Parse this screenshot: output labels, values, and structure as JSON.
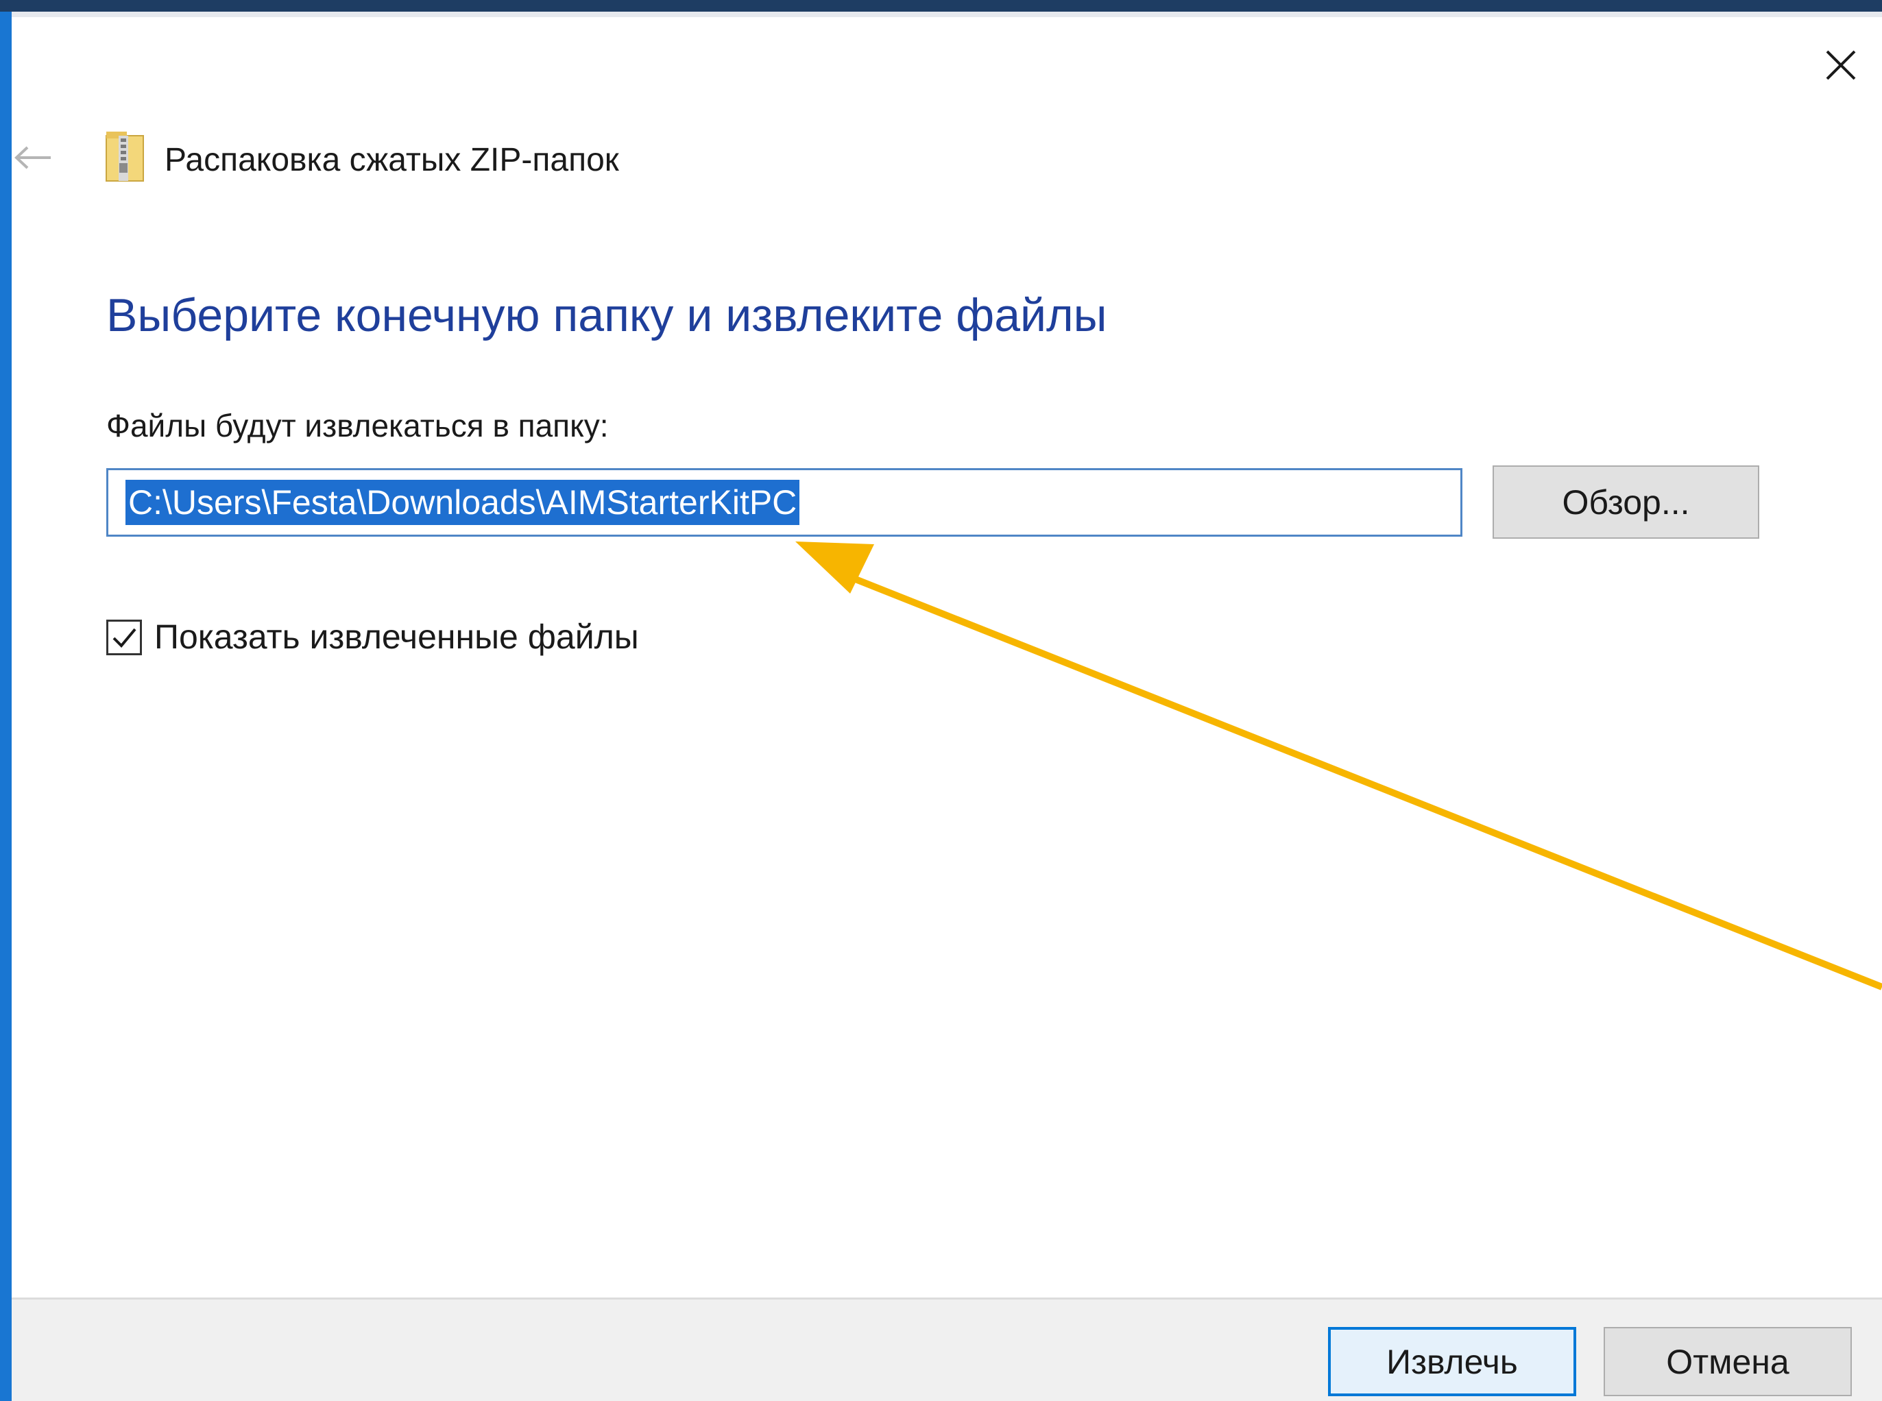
{
  "window": {
    "title": "Распаковка сжатых ZIP-папок",
    "close_icon": "close-icon",
    "back_icon": "back-arrow-icon",
    "app_icon": "zip-folder-icon"
  },
  "main": {
    "heading": "Выберите конечную папку и извлеките файлы",
    "path_label": "Файлы будут извлекаться в папку:",
    "path_value": "C:\\Users\\Festa\\Downloads\\AIMStarterKitPC",
    "path_value_selected": true,
    "browse_label": "Обзор...",
    "show_files_checked": true,
    "show_files_label": "Показать извлеченные файлы"
  },
  "footer": {
    "extract_label": "Извлечь",
    "cancel_label": "Отмена"
  },
  "colors": {
    "heading": "#1f3f9b",
    "selection": "#1e6fd0",
    "annotation_arrow": "#f7b500",
    "left_border": "#1976d2",
    "top_border": "#1e3d63"
  }
}
